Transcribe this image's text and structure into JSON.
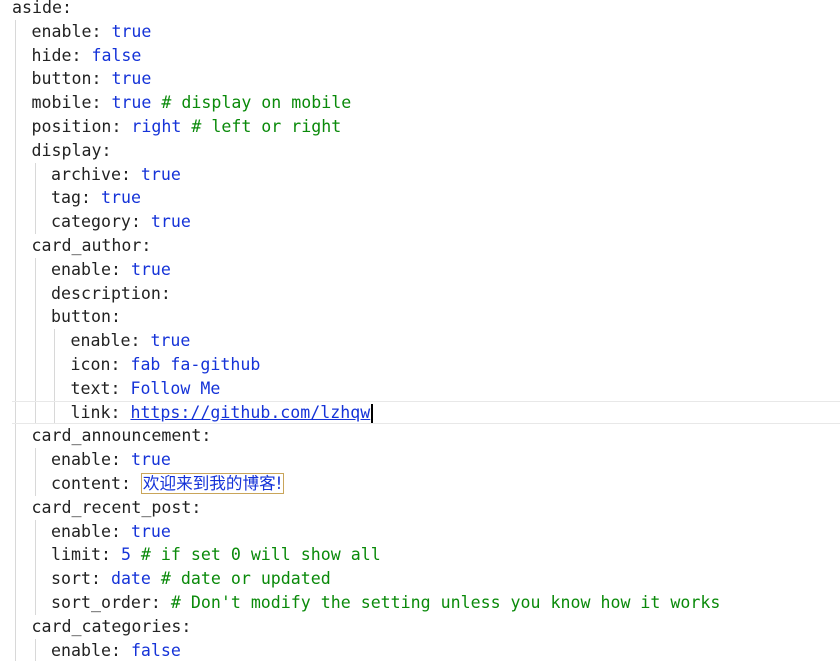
{
  "lines": [
    {
      "key": "aside",
      "sep": ":",
      "indent": 0
    },
    {
      "key": "enable",
      "sep": ": ",
      "value": "true",
      "indent": 1
    },
    {
      "key": "hide",
      "sep": ": ",
      "value": "false",
      "indent": 1
    },
    {
      "key": "button",
      "sep": ": ",
      "value": "true",
      "indent": 1
    },
    {
      "key": "mobile",
      "sep": ": ",
      "value": "true",
      "comment": " # display on mobile",
      "indent": 1
    },
    {
      "key": "position",
      "sep": ": ",
      "value": "right",
      "comment": " # left or right",
      "indent": 1
    },
    {
      "key": "display",
      "sep": ":",
      "indent": 1
    },
    {
      "key": "archive",
      "sep": ": ",
      "value": "true",
      "indent": 2
    },
    {
      "key": "tag",
      "sep": ": ",
      "value": "true",
      "indent": 2
    },
    {
      "key": "category",
      "sep": ": ",
      "value": "true",
      "indent": 2
    },
    {
      "key": "card_author",
      "sep": ":",
      "indent": 1
    },
    {
      "key": "enable",
      "sep": ": ",
      "value": "true",
      "indent": 2
    },
    {
      "key": "description",
      "sep": ":",
      "indent": 2
    },
    {
      "key": "button",
      "sep": ":",
      "indent": 2
    },
    {
      "key": "enable",
      "sep": ": ",
      "value": "true",
      "indent": 3
    },
    {
      "key": "icon",
      "sep": ": ",
      "value": "fab fa-github",
      "indent": 3
    },
    {
      "key": "text",
      "sep": ": ",
      "value": "Follow Me",
      "indent": 3
    },
    {
      "key": "link",
      "sep": ": ",
      "value": "https://github.com/lzhqw",
      "style": "link",
      "indent": 3,
      "current": true
    },
    {
      "key": "card_announcement",
      "sep": ":",
      "indent": 1
    },
    {
      "key": "enable",
      "sep": ": ",
      "value": "true",
      "indent": 2
    },
    {
      "key": "content",
      "sep": ": ",
      "value": "欢迎来到我的博客!",
      "style": "boxed",
      "indent": 2
    },
    {
      "key": "card_recent_post",
      "sep": ":",
      "indent": 1
    },
    {
      "key": "enable",
      "sep": ": ",
      "value": "true",
      "indent": 2
    },
    {
      "key": "limit",
      "sep": ": ",
      "value": "5",
      "comment": " # if set 0 will show all",
      "indent": 2
    },
    {
      "key": "sort",
      "sep": ": ",
      "value": "date",
      "comment": " # date or updated",
      "indent": 2
    },
    {
      "key": "sort_order",
      "sep": ": ",
      "comment": "# Don't modify the setting unless you know how it works",
      "indent": 2
    },
    {
      "key": "card_categories",
      "sep": ":",
      "indent": 1
    },
    {
      "key": "enable",
      "sep": ": ",
      "value": "false",
      "indent": 2
    }
  ]
}
